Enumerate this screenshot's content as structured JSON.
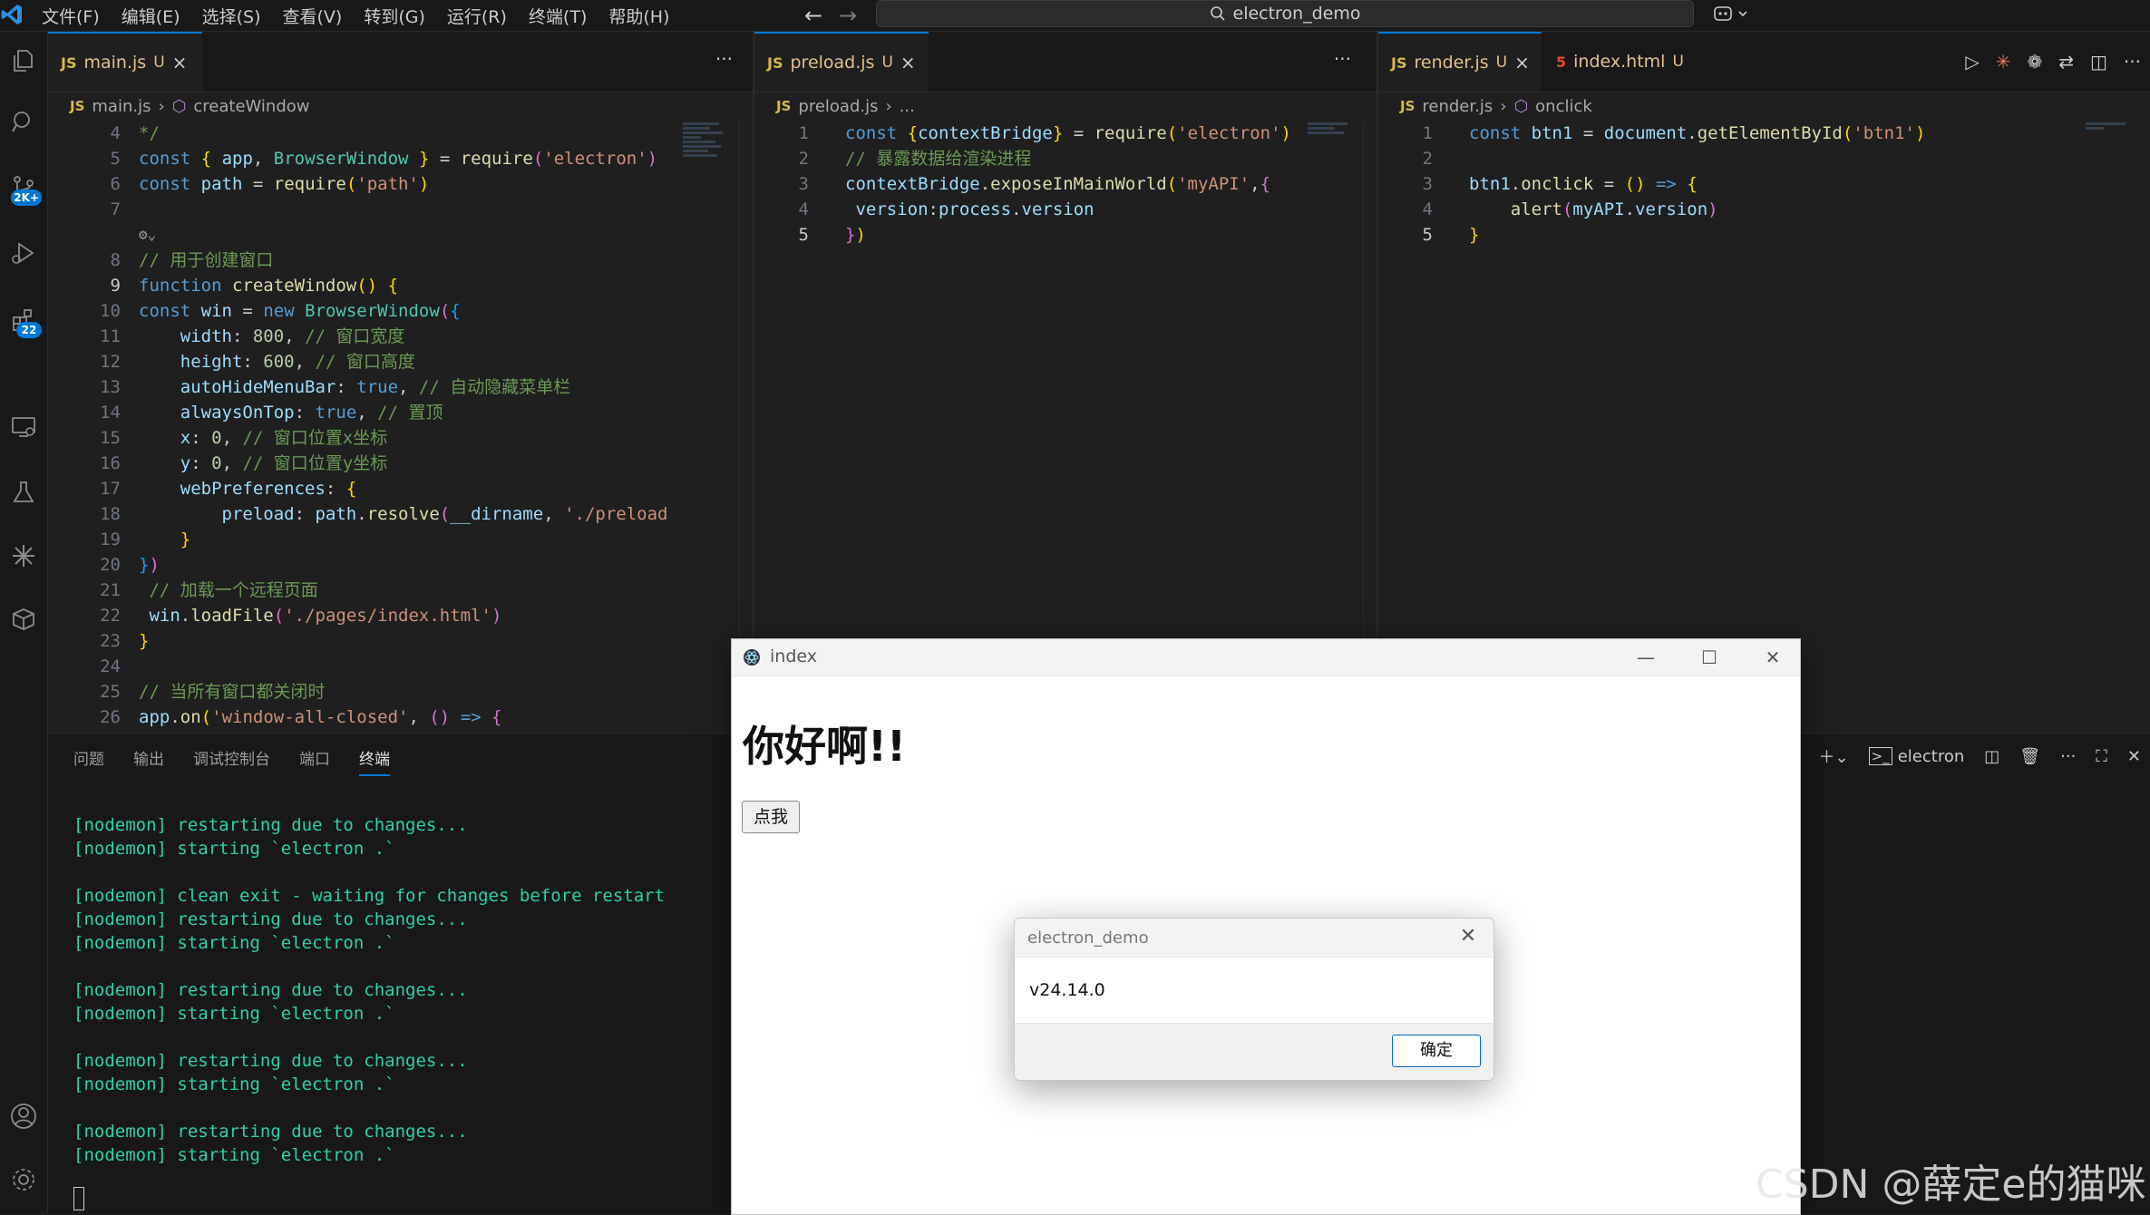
{
  "titlebar": {
    "menu": [
      "文件(F)",
      "编辑(E)",
      "选择(S)",
      "查看(V)",
      "转到(G)",
      "运行(R)",
      "终端(T)",
      "帮助(H)"
    ],
    "search": "electron_demo",
    "nav_back": "←",
    "nav_forward": "→"
  },
  "activitybar": {
    "icons": [
      "explorer-icon",
      "search-icon",
      "source-control-icon",
      "run-debug-icon",
      "extensions-icon",
      "remote-explorer-icon",
      "testing-icon",
      "ai-icon",
      "packages-icon",
      "account-icon",
      "settings-icon"
    ],
    "badges": {
      "source_control": "2K+",
      "extensions": "22"
    }
  },
  "groups": [
    {
      "tabs": [
        {
          "label": "main.js",
          "status": "U",
          "active": true
        }
      ],
      "more": "···",
      "breadcrumb": [
        "main.js",
        "createWindow"
      ]
    },
    {
      "tabs": [
        {
          "label": "preload.js",
          "status": "U",
          "active": true
        }
      ],
      "more": "···",
      "breadcrumb": [
        "preload.js",
        "..."
      ]
    },
    {
      "tabs": [
        {
          "label": "render.js",
          "status": "U",
          "active": true
        },
        {
          "label": "index.html",
          "status": "U",
          "active": false
        }
      ],
      "more": "···",
      "breadcrumb": [
        "render.js",
        "onclick"
      ]
    }
  ],
  "main_js": {
    "line_numbers": [
      "4",
      "5",
      "6",
      "7",
      "",
      "8",
      "9",
      "10",
      "11",
      "12",
      "13",
      "14",
      "15",
      "16",
      "17",
      "18",
      "19",
      "20",
      "21",
      "22",
      "23",
      "24",
      "25",
      "26"
    ],
    "comments": {
      "create": "// 用于创建窗口",
      "width": "// 窗口宽度",
      "height": "// 窗口高度",
      "autohide": "// 自动隐藏菜单栏",
      "ontop": "// 置顶",
      "x": "// 窗口位置x坐标",
      "y": "// 窗口位置y坐标",
      "load": "// 加载一个远程页面",
      "closed": "// 当所有窗口都关闭时"
    }
  },
  "preload_js": {
    "line_numbers": [
      "1",
      "2",
      "3",
      "4",
      "5"
    ],
    "comment": "// 暴露数据给渲染进程"
  },
  "render_js": {
    "line_numbers": [
      "1",
      "2",
      "3",
      "4",
      "5"
    ]
  },
  "panel": {
    "tabs": [
      "问题",
      "输出",
      "调试控制台",
      "端口",
      "终端"
    ],
    "active_tab": "终端",
    "terminal_name": "electron",
    "terminal_lines": [
      "[nodemon] restarting due to changes...",
      "[nodemon] starting `electron .`",
      "",
      "[nodemon] clean exit - waiting for changes before restart",
      "[nodemon] restarting due to changes...",
      "[nodemon] starting `electron .`",
      "",
      "[nodemon] restarting due to changes...",
      "[nodemon] starting `electron .`",
      "",
      "[nodemon] restarting due to changes...",
      "[nodemon] starting `electron .`",
      "",
      "[nodemon] restarting due to changes...",
      "[nodemon] starting `electron .`"
    ]
  },
  "electron_window": {
    "title": "index",
    "heading": "你好啊!!",
    "button": "点我",
    "minimize": "—",
    "maximize": "☐",
    "close": "✕"
  },
  "dialog": {
    "title": "electron_demo",
    "message": "v24.14.0",
    "ok": "确定",
    "close": "✕"
  },
  "watermark": "CSDN @薛定e的猫咪",
  "colors": {
    "accent": "#0078d4",
    "terminal_text": "#2fd1a7",
    "modified": "#e2c08d"
  }
}
